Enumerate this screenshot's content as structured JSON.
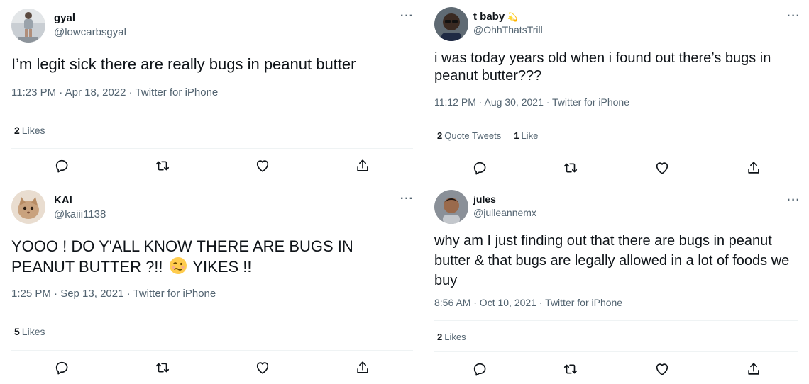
{
  "tweets": [
    {
      "name": "gyal",
      "handle": "@lowcarbsgyal",
      "text": "I’m legit sick there are really bugs in peanut butter",
      "timestamp": "11:23 PM · Apr 18, 2022 · Twitter for iPhone",
      "likes_count": "2",
      "likes_label": "Likes"
    },
    {
      "name": "t baby",
      "name_emoji": "💫",
      "handle": "@OhhThatsTrill",
      "text": "i was today years old when i found out there’s bugs in peanut butter???",
      "timestamp": "11:12 PM · Aug 30, 2021 · Twitter for iPhone",
      "quote_count": "2",
      "quote_label": "Quote Tweets",
      "likes_count": "1",
      "likes_label": "Like"
    },
    {
      "name": "KAI",
      "handle": "@kaiii1138",
      "text_part1": "YOOO ! DO Y'ALL KNOW THERE ARE BUGS IN PEANUT BUTTER ?!!",
      "text_part2": "YIKES !!",
      "timestamp": "1:25 PM · Sep 13, 2021 · Twitter for iPhone",
      "likes_count": "5",
      "likes_label": "Likes"
    },
    {
      "name": "jules",
      "handle": "@julleannemx",
      "text": "why am I just finding out that there are bugs in peanut butter & that bugs are legally allowed in a lot of foods we buy",
      "timestamp": "8:56 AM · Oct 10, 2021 · Twitter for iPhone",
      "likes_count": "2",
      "likes_label": "Likes"
    }
  ],
  "more_glyph": "···",
  "colors": {
    "text": "#0f1419",
    "secondary": "#536471",
    "divider": "#eff3f4",
    "background": "#ffffff"
  },
  "action_icons": [
    "reply-icon",
    "retweet-icon",
    "like-icon",
    "share-icon"
  ]
}
